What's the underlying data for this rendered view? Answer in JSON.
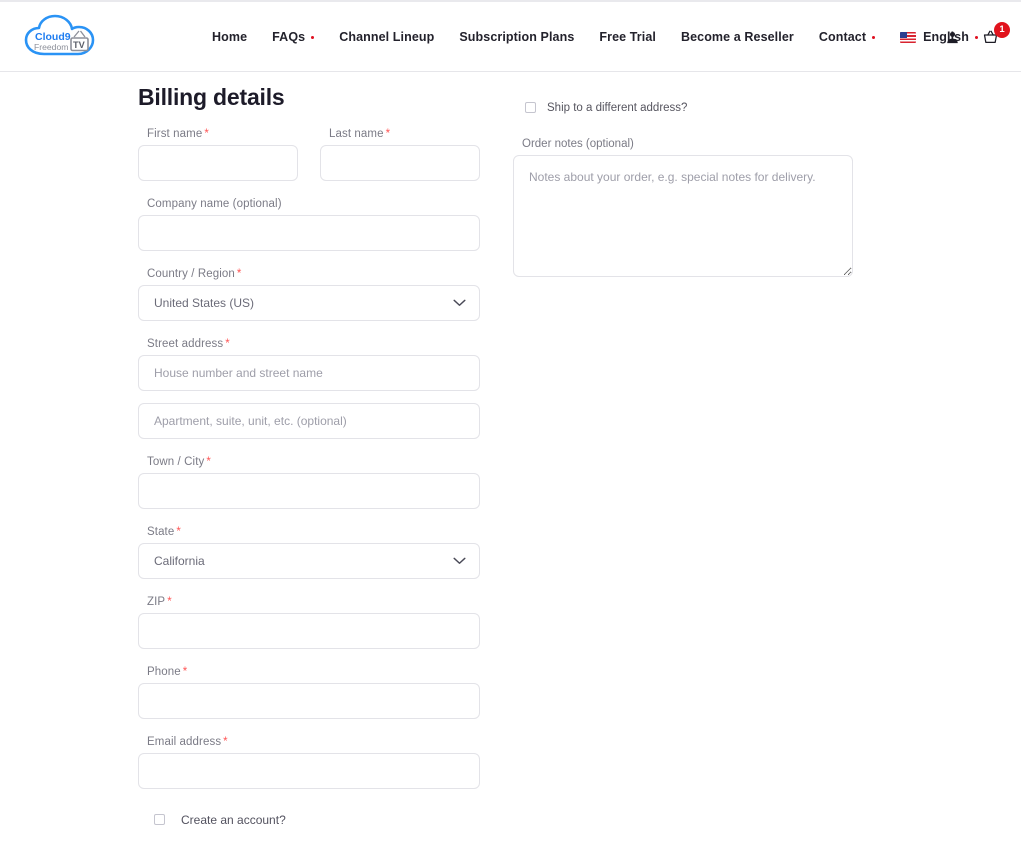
{
  "header": {
    "logo": {
      "brand_primary": "Cloud9",
      "brand_secondary": "Freedom",
      "brand_mark": "TV",
      "color_primary": "#1f7df0",
      "color_secondary": "#8d909a"
    },
    "nav": [
      {
        "label": "Home",
        "has_dropdown": false
      },
      {
        "label": "FAQs",
        "has_dropdown": true
      },
      {
        "label": "Channel Lineup",
        "has_dropdown": false
      },
      {
        "label": "Subscription Plans",
        "has_dropdown": false
      },
      {
        "label": "Free Trial",
        "has_dropdown": false
      },
      {
        "label": "Become a Reseller",
        "has_dropdown": false
      },
      {
        "label": "Contact",
        "has_dropdown": true
      }
    ],
    "language": {
      "label": "English",
      "flag": "us-flag-icon",
      "has_dropdown": true
    },
    "account_icon": "user-icon",
    "cart_icon": "shopping-basket-icon",
    "cart_count": "1",
    "cart_badge_color": "#e1131d",
    "dropdown_dot_color": "#e01020"
  },
  "billing": {
    "title": "Billing details",
    "required_marker": "*",
    "required_color": "#ff5656",
    "fields": {
      "first_name": {
        "label": "First name",
        "required": true,
        "value": "",
        "placeholder": ""
      },
      "last_name": {
        "label": "Last name",
        "required": true,
        "value": "",
        "placeholder": ""
      },
      "company_name": {
        "label": "Company name (optional)",
        "required": false,
        "value": "",
        "placeholder": ""
      },
      "country": {
        "label": "Country / Region",
        "required": true,
        "value": "United States (US)"
      },
      "street_address": {
        "label": "Street address",
        "required": true,
        "value": "",
        "placeholder": "House number and street name"
      },
      "address_line_2": {
        "label": "",
        "required": false,
        "value": "",
        "placeholder": "Apartment, suite, unit, etc. (optional)"
      },
      "town_city": {
        "label": "Town / City",
        "required": true,
        "value": "",
        "placeholder": ""
      },
      "state": {
        "label": "State",
        "required": true,
        "value": "California"
      },
      "zip": {
        "label": "ZIP",
        "required": true,
        "value": "",
        "placeholder": ""
      },
      "phone": {
        "label": "Phone",
        "required": true,
        "value": "",
        "placeholder": ""
      },
      "email": {
        "label": "Email address",
        "required": true,
        "value": "",
        "placeholder": ""
      }
    },
    "create_account": {
      "label": "Create an account?",
      "checked": false
    }
  },
  "shipping": {
    "ship_different": {
      "label": "Ship to a different address?",
      "checked": false
    },
    "order_notes": {
      "label": "Order notes (optional)",
      "value": "",
      "placeholder": "Notes about your order, e.g. special notes for delivery."
    }
  },
  "icons": {
    "chevron_down": "chevron-down-icon"
  }
}
